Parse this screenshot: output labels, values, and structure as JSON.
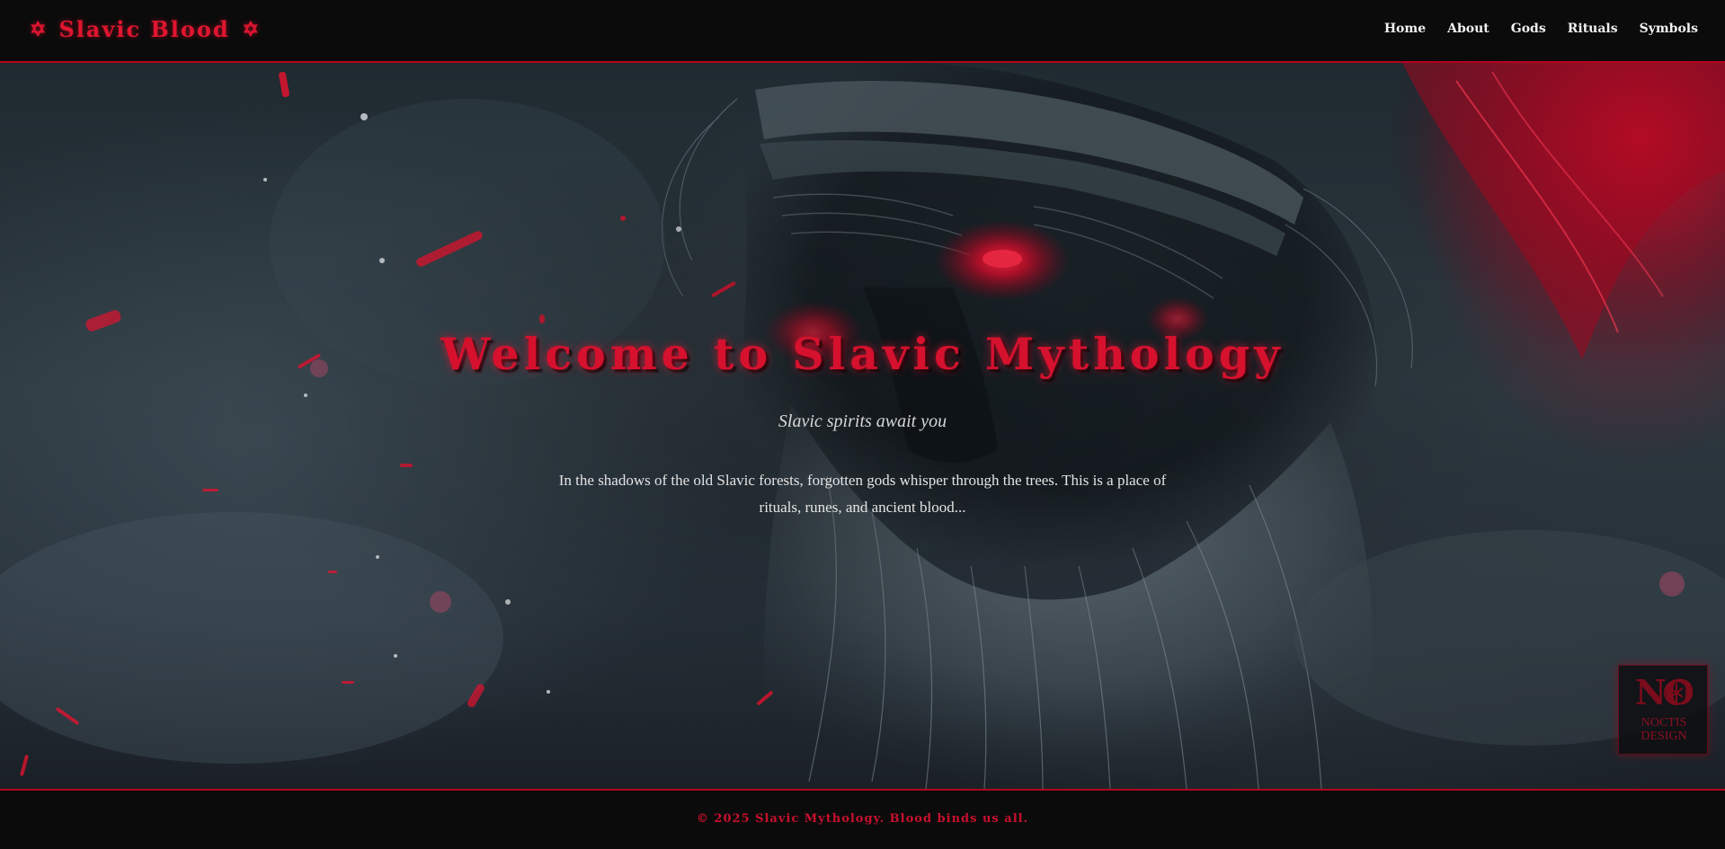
{
  "brand": {
    "title": "Slavic Blood",
    "icon_left": "✡",
    "icon_right": "✡",
    "icon_name": "pentagram-icon"
  },
  "nav": {
    "items": [
      {
        "label": "Home"
      },
      {
        "label": "About"
      },
      {
        "label": "Gods"
      },
      {
        "label": "Rituals"
      },
      {
        "label": "Symbols"
      }
    ]
  },
  "hero": {
    "background_image": "hero-image-bearded-deity-glowing-red-eyes",
    "title": "Welcome to Slavic Mythology",
    "subtitle": "Slavic spirits await you",
    "text": "In the shadows of the old Slavic forests, forgotten gods whisper through the trees. This is a place of rituals, runes, and ancient blood..."
  },
  "badge": {
    "mark": "NO",
    "line1": "NOCTIS",
    "line2": "DESIGN"
  },
  "footer": {
    "text": "© 2025 Slavic Mythology. Blood binds us all."
  },
  "colors": {
    "accent": "#c8102e",
    "background": "#0b0b0b",
    "nav_text": "#f2f2f2"
  }
}
